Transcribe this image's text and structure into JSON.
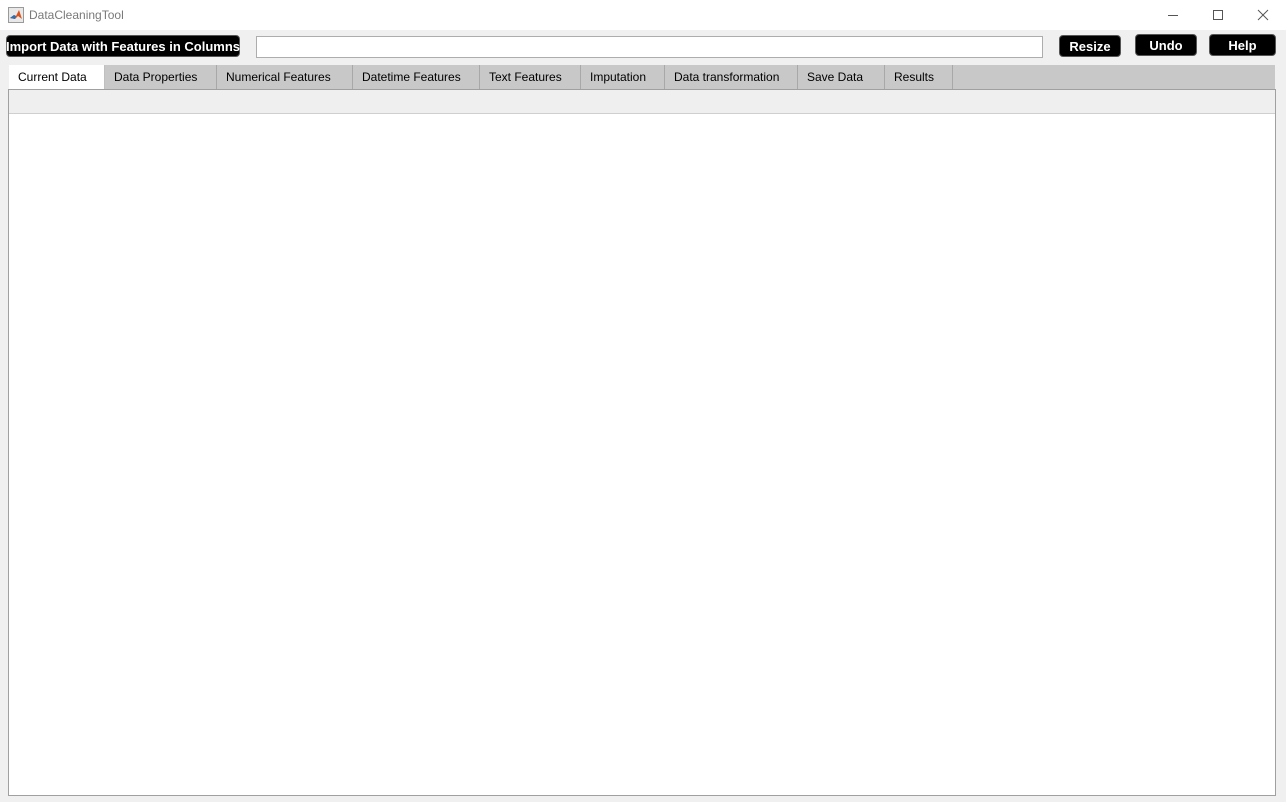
{
  "window": {
    "title": "DataCleaningTool",
    "icon": "matlab-logo-icon",
    "controls": [
      "minimize-icon",
      "maximize-icon",
      "close-icon"
    ]
  },
  "toolbar": {
    "import_label": "Import Data with Features in Columns",
    "path_value": "",
    "resize_label": "Resize",
    "undo_label": "Undo",
    "help_label": "Help"
  },
  "tabs": [
    {
      "label": "Current Data",
      "active": true
    },
    {
      "label": "Data Properties",
      "active": false
    },
    {
      "label": "Numerical Features",
      "active": false
    },
    {
      "label": "Datetime Features",
      "active": false
    },
    {
      "label": "Text Features",
      "active": false
    },
    {
      "label": "Imputation",
      "active": false
    },
    {
      "label": "Data transformation",
      "active": false
    },
    {
      "label": "Save Data",
      "active": false
    },
    {
      "label": "Results",
      "active": false
    }
  ],
  "colors": {
    "button_bg": "#000000",
    "button_text": "#ffffff",
    "tab_bar": "#c8c8c8",
    "active_tab": "#ffffff",
    "window_bg": "#f0f0f0"
  }
}
